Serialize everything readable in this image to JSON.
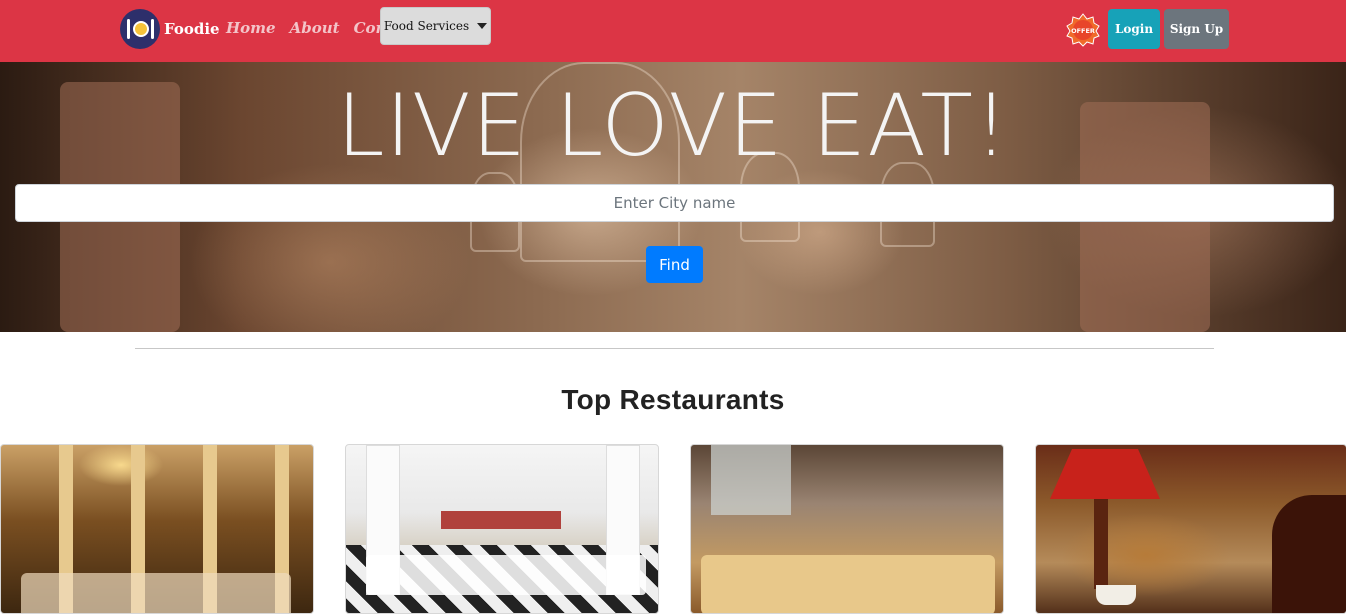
{
  "navbar": {
    "brand_name": "Foodie",
    "links": [
      "Home",
      "About",
      "Contact"
    ],
    "dropdown_label": "Food Services",
    "offer_badge_text": "OFFER",
    "login_label": "Login",
    "signup_label": "Sign Up",
    "colors": {
      "navbar": "#dc3545",
      "login": "#17a2b8",
      "signup": "#6c757d"
    }
  },
  "hero": {
    "title": "LIVE LOVE EAT!",
    "search_placeholder": "Enter City name",
    "find_label": "Find",
    "find_color": "#007bff"
  },
  "section": {
    "title": "Top Restaurants"
  },
  "cards": [
    {
      "image": "restaurant-photo-1"
    },
    {
      "image": "restaurant-photo-2"
    },
    {
      "image": "restaurant-photo-3"
    },
    {
      "image": "restaurant-photo-4"
    }
  ]
}
